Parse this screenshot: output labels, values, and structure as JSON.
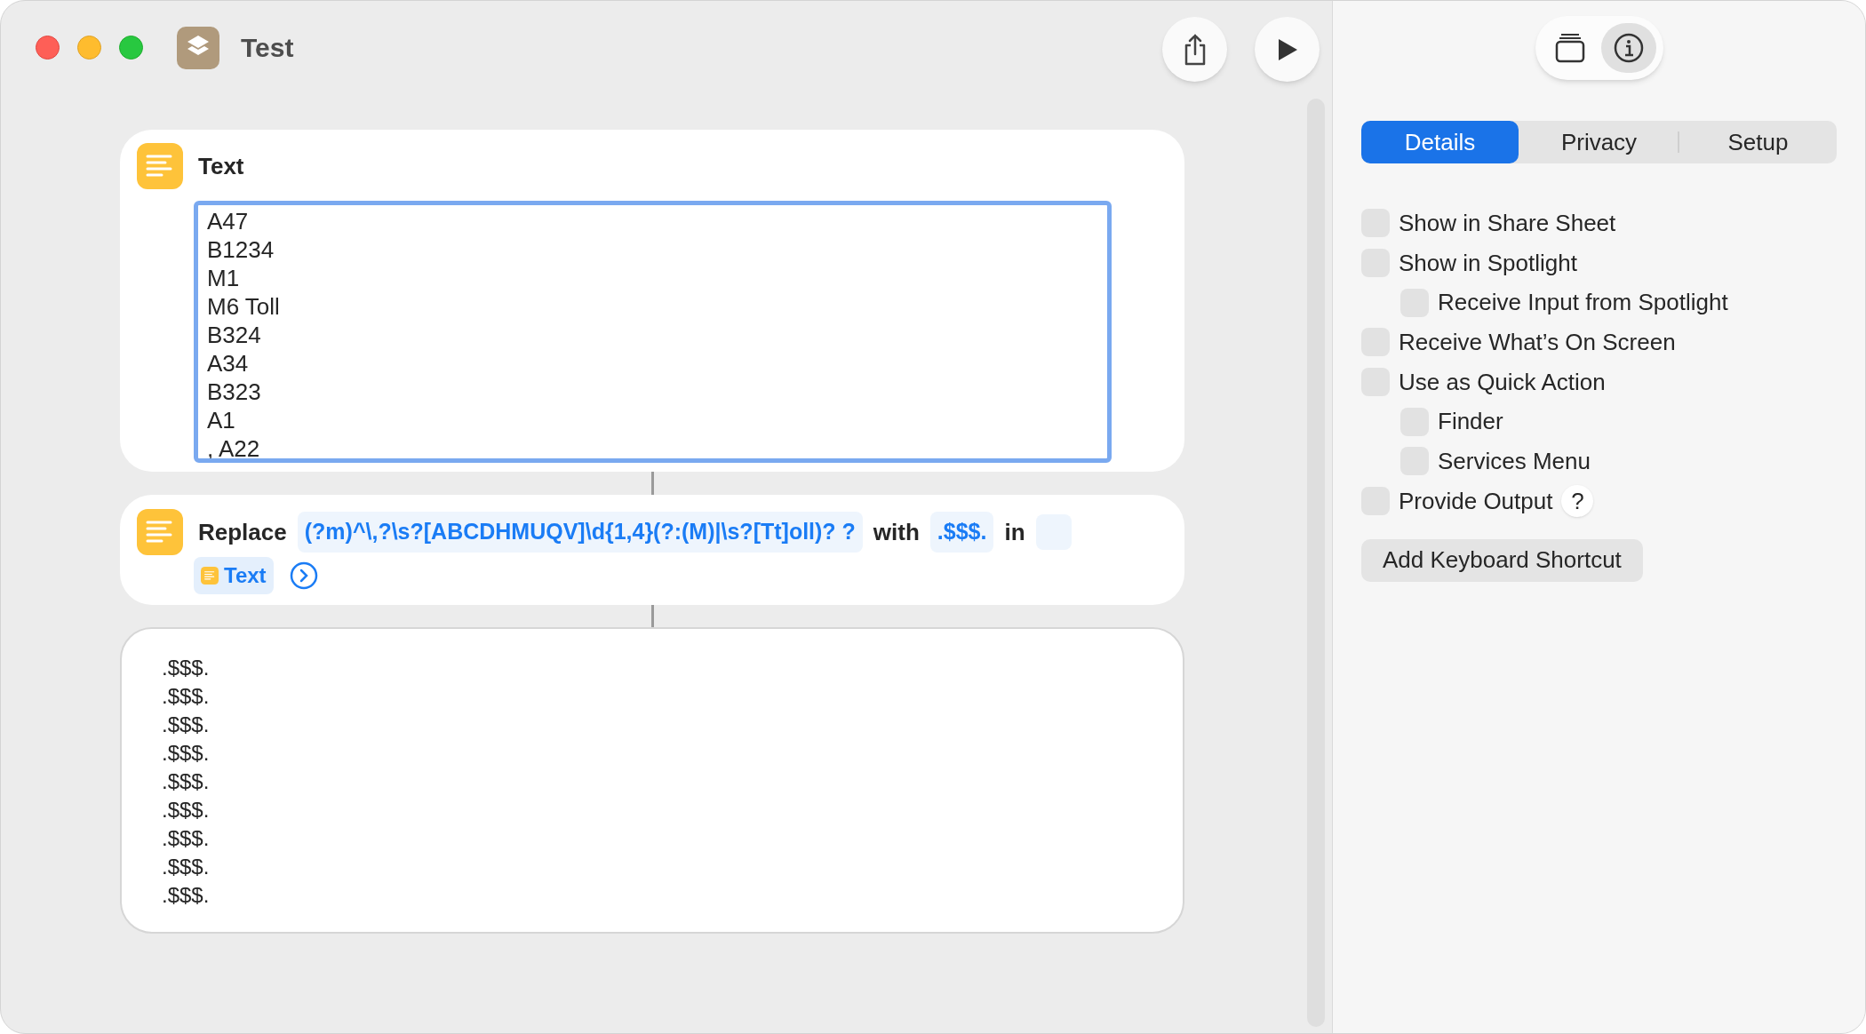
{
  "window": {
    "title": "Test"
  },
  "toolbar": {
    "share_button": {
      "selected": false
    },
    "run_button": {
      "selected": false
    }
  },
  "text_action": {
    "title": "Text",
    "focused": true,
    "lines": [
      "A47",
      "B1234",
      "M1",
      "M6 Toll",
      "B324",
      "A34",
      "B323",
      "A1",
      ", A22"
    ]
  },
  "replace_action": {
    "label": "Replace",
    "pattern": "(?m)^\\,?\\s?[ABCDHMUQV]\\d{1,4}(?:(M)|\\s?[Tt]oll)? ?",
    "with_label": "with",
    "replacement": ".$$$.",
    "in_label": "in",
    "variable": "Text",
    "expanded": false
  },
  "output": {
    "lines": [
      ".$$$.",
      ".$$$.",
      ".$$$.",
      ".$$$.",
      ".$$$.",
      ".$$$.",
      ".$$$.",
      ".$$$.",
      ".$$$."
    ]
  },
  "sidebar": {
    "library_button": {
      "selected": false
    },
    "info_button": {
      "selected": true
    },
    "tabs": [
      {
        "label": "Details",
        "selected": true
      },
      {
        "label": "Privacy",
        "selected": false
      },
      {
        "label": "Setup",
        "selected": false
      }
    ],
    "options": [
      {
        "label": "Show in Share Sheet",
        "checked": false
      },
      {
        "label": "Show in Spotlight",
        "checked": false,
        "children": [
          {
            "label": "Receive Input from Spotlight",
            "checked": false
          }
        ]
      },
      {
        "label": "Receive What’s On Screen",
        "checked": false
      },
      {
        "label": "Use as Quick Action",
        "checked": false,
        "children": [
          {
            "label": "Finder",
            "checked": false
          },
          {
            "label": "Services Menu",
            "checked": false
          }
        ]
      },
      {
        "label": "Provide Output",
        "checked": false,
        "help": "?"
      }
    ],
    "shortcut_button": "Add Keyboard Shortcut"
  }
}
